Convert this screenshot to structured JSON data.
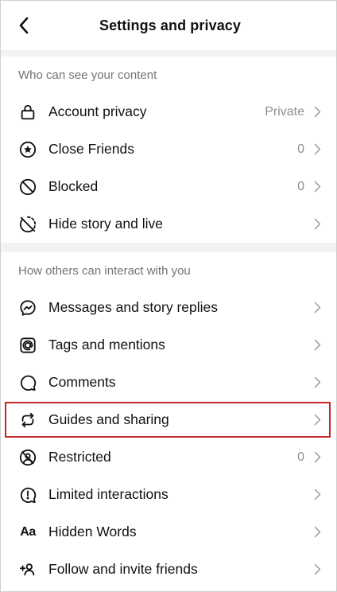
{
  "header": {
    "title": "Settings and privacy"
  },
  "sections": [
    {
      "heading": "Who can see your content",
      "items": [
        {
          "label": "Account privacy",
          "value": "Private",
          "icon": "lock-icon"
        },
        {
          "label": "Close Friends",
          "value": "0",
          "icon": "star-circle-icon"
        },
        {
          "label": "Blocked",
          "value": "0",
          "icon": "blocked-icon"
        },
        {
          "label": "Hide story and live",
          "value": "",
          "icon": "hide-story-icon"
        }
      ]
    },
    {
      "heading": "How others can interact with you",
      "items": [
        {
          "label": "Messages and story replies",
          "value": "",
          "icon": "messenger-icon"
        },
        {
          "label": "Tags and mentions",
          "value": "",
          "icon": "at-sign-icon"
        },
        {
          "label": "Comments",
          "value": "",
          "icon": "comment-icon"
        },
        {
          "label": "Guides and sharing",
          "value": "",
          "icon": "share-arrows-icon",
          "highlighted": true
        },
        {
          "label": "Restricted",
          "value": "0",
          "icon": "restricted-icon"
        },
        {
          "label": "Limited interactions",
          "value": "",
          "icon": "limited-icon"
        },
        {
          "label": "Hidden Words",
          "value": "",
          "icon": "hidden-words-icon",
          "icon_text": "Aa"
        },
        {
          "label": "Follow and invite friends",
          "value": "",
          "icon": "add-person-icon"
        }
      ]
    }
  ],
  "colors": {
    "highlight": "#c0262c",
    "muted": "#8e8e8e",
    "section_bg": "#f2f2f2"
  }
}
